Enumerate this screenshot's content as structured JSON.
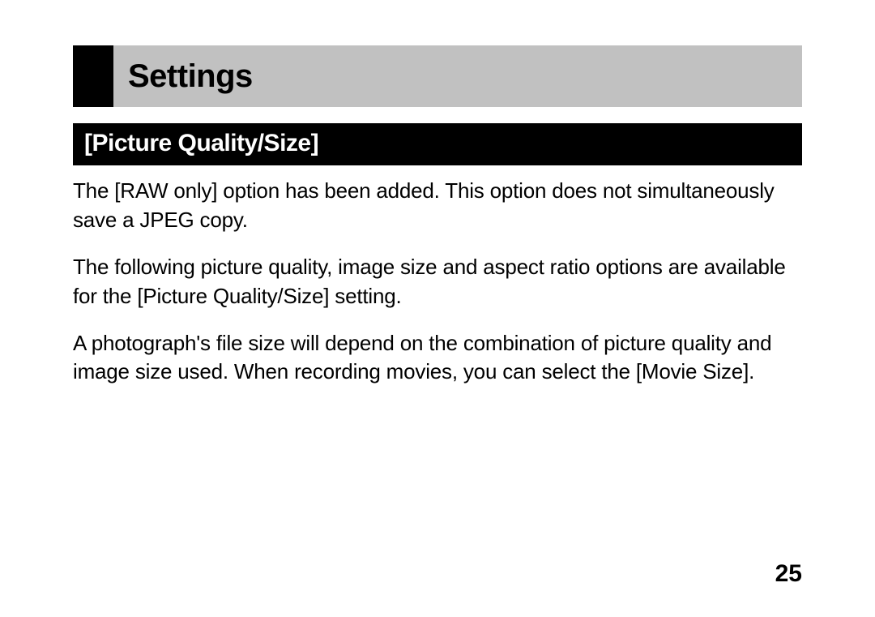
{
  "header": {
    "title": "Settings"
  },
  "subheader": {
    "title": "[Picture Quality/Size]"
  },
  "paragraphs": {
    "p1": "The [RAW only] option has been added. This option does not simultaneously save a JPEG copy.",
    "p2": "The following picture quality, image size and aspect ratio options are available for the [Picture Quality/Size] setting.",
    "p3": "A photograph's file size will depend on the combination of picture quality and image size used. When recording movies, you can select the [Movie Size]."
  },
  "pageNumber": "25"
}
